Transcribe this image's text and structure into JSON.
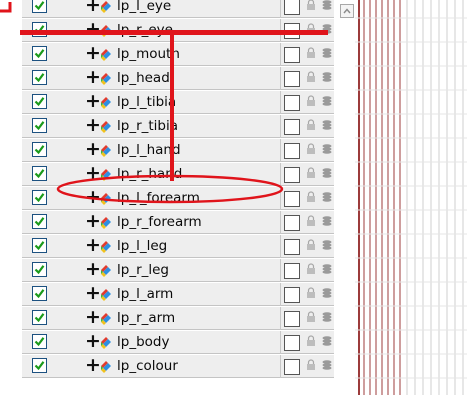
{
  "layers": [
    {
      "name": "lp_l_eye",
      "checked": true
    },
    {
      "name": "lp_r_eye",
      "checked": true
    },
    {
      "name": "lp_mouth",
      "checked": true
    },
    {
      "name": "lp_head",
      "checked": true
    },
    {
      "name": "lp_l_tibia",
      "checked": true
    },
    {
      "name": "lp_r_tibia",
      "checked": true
    },
    {
      "name": "lp_l_hand",
      "checked": true
    },
    {
      "name": "lp_r_hand",
      "checked": true
    },
    {
      "name": "lp_l_forearm",
      "checked": true
    },
    {
      "name": "lp_r_forearm",
      "checked": true
    },
    {
      "name": "lp_l_leg",
      "checked": true
    },
    {
      "name": "lp_r_leg",
      "checked": true
    },
    {
      "name": "lp_l_arm",
      "checked": true
    },
    {
      "name": "lp_r_arm",
      "checked": true
    },
    {
      "name": "lp_body",
      "checked": true
    },
    {
      "name": "lp_colour",
      "checked": true
    }
  ],
  "icons": {
    "expand": "plus-icon",
    "peg": "peg-icon",
    "lock": "lock-icon",
    "disc": "disc-icon"
  },
  "expand_symbol": "+",
  "highlighted_layer": "lp_r_hand",
  "colors": {
    "annotation_red": "#e0141b",
    "checkbox_check": "#1a9a1a",
    "row_bg": "#eeeeee",
    "timeline_line": "#9c3b3b"
  }
}
